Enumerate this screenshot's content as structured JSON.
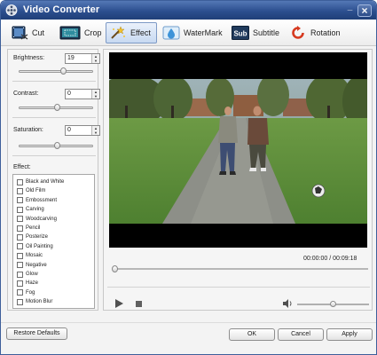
{
  "window": {
    "title": "Video Converter"
  },
  "tabs": [
    {
      "label": "Cut",
      "icon": "cut-film-icon"
    },
    {
      "label": "Crop",
      "icon": "crop-screen-icon"
    },
    {
      "label": "Effect",
      "icon": "effect-wand-icon",
      "active": true
    },
    {
      "label": "WaterMark",
      "icon": "watermark-drop-icon"
    },
    {
      "label": "Subtitle",
      "icon": "subtitle-sub-icon"
    },
    {
      "label": "Rotation",
      "icon": "rotation-arrow-icon"
    }
  ],
  "subtitle_icon_text": "Sub",
  "adjustments": {
    "brightness": {
      "label": "Brightness:",
      "value": "19",
      "level": 0.6
    },
    "contrast": {
      "label": "Contrast:",
      "value": "0",
      "level": 0.5
    },
    "saturation": {
      "label": "Saturation:",
      "value": "0",
      "level": 0.5
    }
  },
  "effects": {
    "label": "Effect:",
    "items": [
      {
        "label": "Black and White",
        "checked": false
      },
      {
        "label": "Old Film",
        "checked": false
      },
      {
        "label": "Embossment",
        "checked": false
      },
      {
        "label": "Carving",
        "checked": false
      },
      {
        "label": "Woodcarving",
        "checked": false
      },
      {
        "label": "Pencil",
        "checked": false
      },
      {
        "label": "Posterize",
        "checked": false
      },
      {
        "label": "Oil Painting",
        "checked": false
      },
      {
        "label": "Mosaic",
        "checked": false
      },
      {
        "label": "Negative",
        "checked": false
      },
      {
        "label": "Glow",
        "checked": false
      },
      {
        "label": "Haze",
        "checked": false
      },
      {
        "label": "Fog",
        "checked": false
      },
      {
        "label": "Motion Blur",
        "checked": false
      }
    ]
  },
  "player": {
    "current_time": "00:00:00",
    "separator": "/",
    "total_time": "00:09:18",
    "progress": 0,
    "volume_level": 0.5
  },
  "buttons": {
    "restore_defaults": "Restore Defaults",
    "ok": "OK",
    "cancel": "Cancel",
    "apply": "Apply"
  },
  "colors": {
    "title_bar": "#2c4f8f",
    "active_tab": "#c8d9f1"
  }
}
